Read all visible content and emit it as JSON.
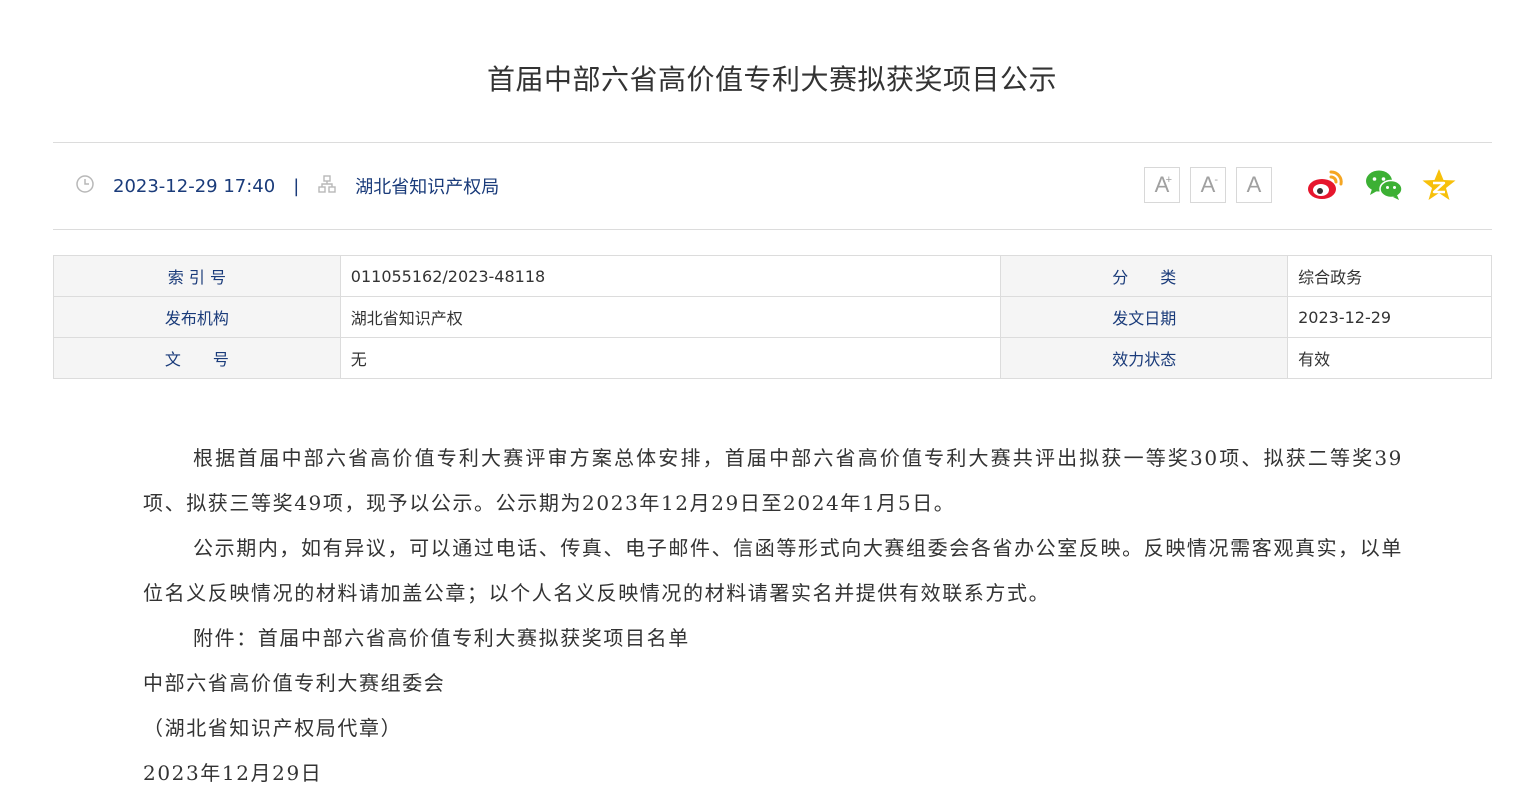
{
  "title": "首届中部六省高价值专利大赛拟获奖项目公示",
  "meta": {
    "datetime": "2023-12-29 17:40",
    "separator": "|",
    "source": "湖北省知识产权局",
    "icons": {
      "time": "clock-icon",
      "source": "sitemap-icon"
    }
  },
  "font_controls": {
    "increase": "A",
    "increase_sup": "+",
    "decrease": "A",
    "decrease_sup": "-",
    "reset": "A"
  },
  "share": {
    "weibo": "weibo-icon",
    "wechat": "wechat-icon",
    "qzone": "qzone-icon",
    "colors": {
      "weibo": "#e6162d",
      "weibo_ring": "#f5a623",
      "wechat": "#3cb034",
      "qzone": "#f7c00a"
    }
  },
  "info_table": {
    "rows": [
      {
        "label1": "索 引 号",
        "value1": "011055162/2023-48118",
        "label2": "分　　类",
        "value2": "综合政务"
      },
      {
        "label1": "发布机构",
        "value1": "湖北省知识产权",
        "label2": "发文日期",
        "value2": "2023-12-29"
      },
      {
        "label1": "文　　号",
        "value1": "无",
        "label2": "效力状态",
        "value2": "有效"
      }
    ]
  },
  "body": {
    "paragraphs": [
      "根据首届中部六省高价值专利大赛评审方案总体安排，首届中部六省高价值专利大赛共评出拟获一等奖30项、拟获二等奖39项、拟获三等奖49项，现予以公示。公示期为2023年12月29日至2024年1月5日。",
      "公示期内，如有异议，可以通过电话、传真、电子邮件、信函等形式向大赛组委会各省办公室反映。反映情况需客观真实，以单位名义反映情况的材料请加盖公章；以个人名义反映情况的材料请署实名并提供有效联系方式。",
      "附件：首届中部六省高价值专利大赛拟获奖项目名单"
    ],
    "signature": {
      "org": "中部六省高价值专利大赛组委会",
      "note": "（湖北省知识产权局代章）",
      "date": "2023年12月29日"
    }
  },
  "colors": {
    "accent": "#1a3b7a",
    "label_bg": "#f5f5f5",
    "border": "#dcdcdc"
  }
}
